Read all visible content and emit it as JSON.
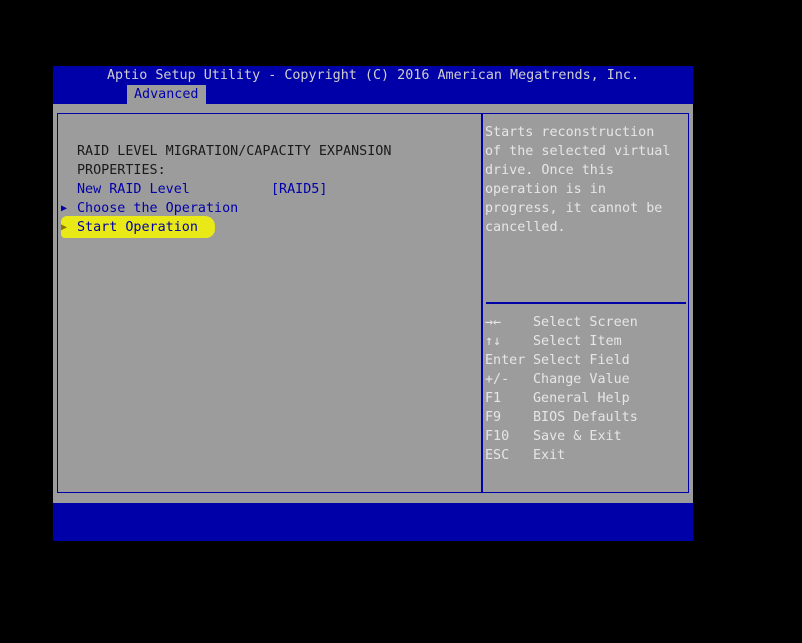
{
  "header": {
    "title": "Aptio Setup Utility - Copyright (C) 2016 American Megatrends, Inc.",
    "tab": "Advanced"
  },
  "main": {
    "heading_line1": "RAID LEVEL MIGRATION/CAPACITY EXPANSION",
    "heading_line2": "PROPERTIES:",
    "raid_level_label": "New RAID Level",
    "raid_level_value": "[RAID5]",
    "choose_operation": "Choose the Operation",
    "start_operation": "Start Operation"
  },
  "help": {
    "lines": [
      "Starts reconstruction",
      "of the selected virtual",
      "drive. Once this",
      "operation is in",
      "progress, it cannot be",
      "cancelled."
    ]
  },
  "keys": [
    {
      "key": "→←",
      "action": "Select Screen"
    },
    {
      "key": "↑↓",
      "action": "Select Item"
    },
    {
      "key": "Enter",
      "action": "Select Field"
    },
    {
      "key": "+/-",
      "action": "Change Value"
    },
    {
      "key": "F1",
      "action": "General Help"
    },
    {
      "key": "F9",
      "action": "BIOS Defaults"
    },
    {
      "key": "F10",
      "action": "Save & Exit"
    },
    {
      "key": "ESC",
      "action": "Exit"
    }
  ],
  "colors": {
    "bar_blue": "#0000a8",
    "panel_gray": "#9c9c9c",
    "highlight": "#f2f20a"
  }
}
